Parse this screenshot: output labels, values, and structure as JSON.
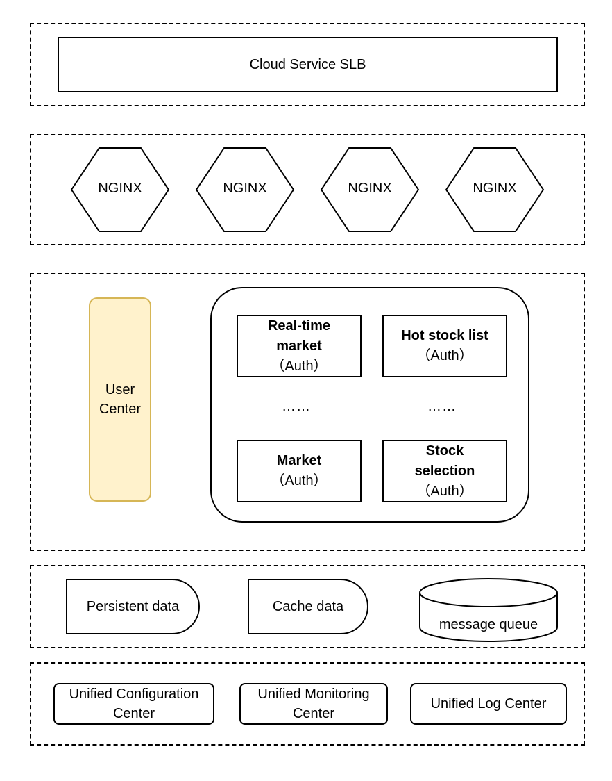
{
  "layers": {
    "load_balancer": {
      "label": "Cloud Service SLB"
    },
    "gateway": {
      "nodes": [
        "NGINX",
        "NGINX",
        "NGINX",
        "NGINX"
      ]
    },
    "services": {
      "user_center": {
        "label": "User Center",
        "fill": "#fff2cc",
        "stroke": "#d6b656"
      },
      "business_services": [
        {
          "title": "Real-time market",
          "auth": "（Auth）"
        },
        {
          "title": "Hot stock list",
          "auth": "（Auth）"
        },
        {
          "title": "Market",
          "auth": "（Auth）"
        },
        {
          "title": "Stock selection",
          "auth": "（Auth）"
        }
      ],
      "ellipsis": [
        "……",
        "……"
      ]
    },
    "data": {
      "persistent": "Persistent data",
      "cache": "Cache data",
      "queue": "message queue"
    },
    "infrastructure": {
      "config": "Unified Configuration Center",
      "monitoring": "Unified Monitoring Center",
      "log": "Unified Log Center"
    }
  }
}
